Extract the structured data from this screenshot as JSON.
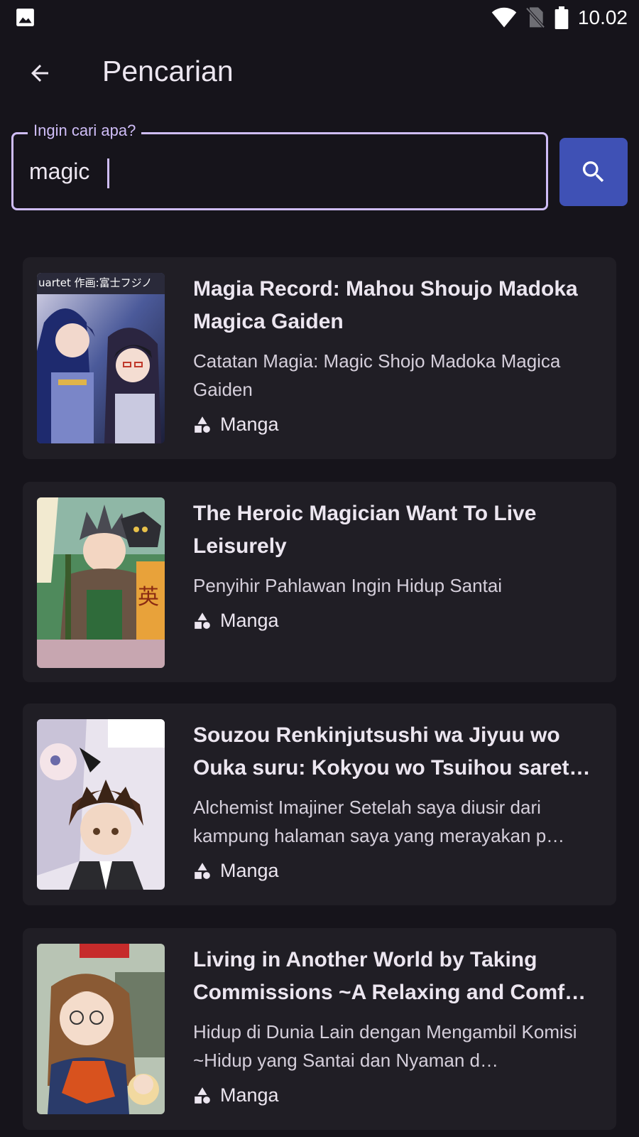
{
  "status_bar": {
    "time": "10.02",
    "icons": [
      "gallery-icon",
      "wifi-icon",
      "no-sim-icon",
      "battery-icon"
    ]
  },
  "app_bar": {
    "title": "Pencarian",
    "back_icon": "arrow-left-icon"
  },
  "search": {
    "label": "Ingin cari apa?",
    "value": "magic",
    "button_icon": "search-icon"
  },
  "colors": {
    "background": "#16141b",
    "card": "#201e25",
    "accent_outline": "#cfbdf7",
    "search_button": "#3f51b5"
  },
  "results": [
    {
      "title": "Magia Record: Mahou Shoujo Madoka Magica Gaiden",
      "subtitle": "Catatan Magia: Magic Shojo Madoka Magica Gaiden",
      "type": "Manga",
      "cover_text": "uartet 作画:富士フジノ"
    },
    {
      "title": "The Heroic Magician Want To Live Leisurely",
      "subtitle": "Penyihir Pahlawan Ingin Hidup Santai",
      "type": "Manga"
    },
    {
      "title": "Souzou Renkinjutsushi wa Jiyuu wo Ouka suru: Kokyou wo Tsuihou saret…",
      "subtitle": "Alchemist Imajiner Setelah saya diusir dari kampung halaman saya yang merayakan p…",
      "type": "Manga"
    },
    {
      "title": "Living in Another World by Taking Commissions ~A Relaxing and Comf…",
      "subtitle": "Hidup di Dunia Lain dengan Mengambil Komisi ~Hidup yang Santai dan Nyaman d…",
      "type": "Manga"
    }
  ]
}
